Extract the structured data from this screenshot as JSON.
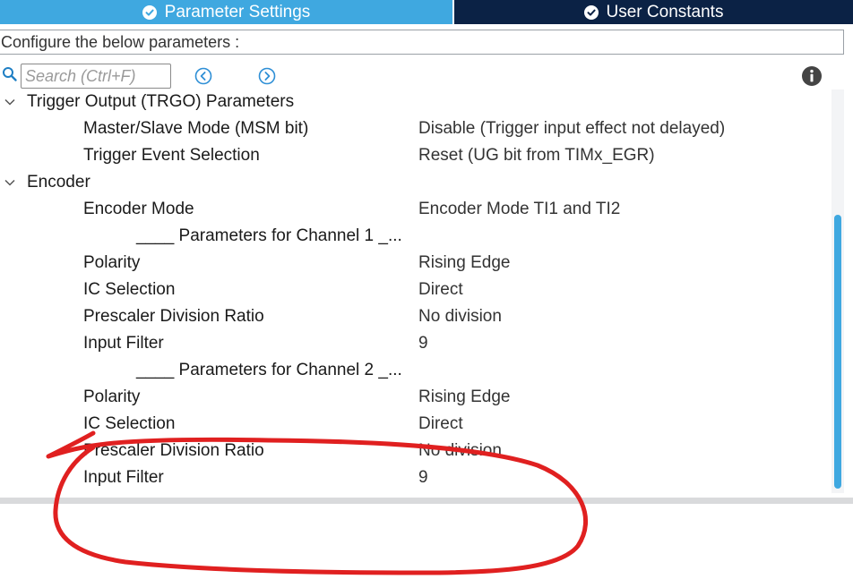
{
  "tabs": [
    {
      "label": "Parameter Settings",
      "active": true,
      "icon": "check-circle-icon"
    },
    {
      "label": "User Constants",
      "active": false,
      "icon": "check-circle-icon"
    }
  ],
  "configure_text": "Configure the below parameters :",
  "search": {
    "placeholder": "Search (Ctrl+F)"
  },
  "toolbar_icons": [
    "search-icon",
    "previous-icon",
    "next-icon",
    "info-icon"
  ],
  "tree": {
    "groups": [
      {
        "label": "Trigger Output (TRGO) Parameters",
        "expanded": true,
        "rows": [
          {
            "name": "Master/Slave Mode (MSM bit)",
            "value": "Disable (Trigger input effect not delayed)"
          },
          {
            "name": "Trigger Event Selection",
            "value": "Reset (UG bit from TIMx_EGR)"
          }
        ]
      },
      {
        "label": "Encoder",
        "expanded": true,
        "rows": [
          {
            "name": "Encoder Mode",
            "value": "Encoder Mode TI1 and TI2"
          },
          {
            "subheader": "____ Parameters for Channel 1 _..."
          },
          {
            "name": "Polarity",
            "value": "Rising Edge"
          },
          {
            "name": "IC Selection",
            "value": "Direct"
          },
          {
            "name": "Prescaler Division Ratio",
            "value": "No division"
          },
          {
            "name": "Input Filter",
            "value": "9"
          },
          {
            "subheader": "____ Parameters for Channel 2 _..."
          },
          {
            "name": "Polarity",
            "value": "Rising Edge"
          },
          {
            "name": "IC Selection",
            "value": "Direct"
          },
          {
            "name": "Prescaler Division Ratio",
            "value": "No division"
          },
          {
            "name": "Input Filter",
            "value": "9"
          }
        ]
      }
    ]
  },
  "colors": {
    "tab_active": "#3fa8e0",
    "tab_inactive": "#0b2245",
    "scroll_thumb": "#3fa8e0",
    "annotation": "#e02020"
  }
}
